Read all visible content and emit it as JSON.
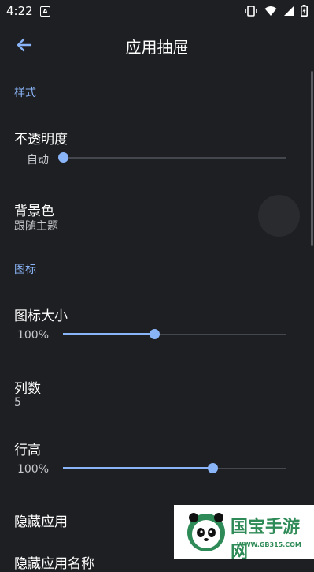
{
  "status_bar": {
    "time": "4:22",
    "badge": "A"
  },
  "toolbar": {
    "title": "应用抽屉"
  },
  "sections": {
    "style": "样式",
    "icons": "图标"
  },
  "opacity": {
    "title": "不透明度",
    "slider_label": "自动",
    "value_fraction": 0.0
  },
  "background": {
    "title": "背景色",
    "summary": "跟随主题"
  },
  "icon_size": {
    "title": "图标大小",
    "slider_label": "100%",
    "value_fraction": 0.41
  },
  "columns": {
    "title": "列数",
    "summary": "5"
  },
  "row_height": {
    "title": "行高",
    "slider_label": "100%",
    "value_fraction": 0.67
  },
  "hidden_apps": {
    "title": "隐藏应用"
  },
  "next_item_partial": {
    "title": "隐藏应用名称"
  },
  "watermark": {
    "title": "国宝手游网",
    "url": "WWW.GB315.COM"
  },
  "colors": {
    "background": "#1e1f22",
    "accent": "#8ab4f8",
    "section": "#8ab4f8"
  }
}
